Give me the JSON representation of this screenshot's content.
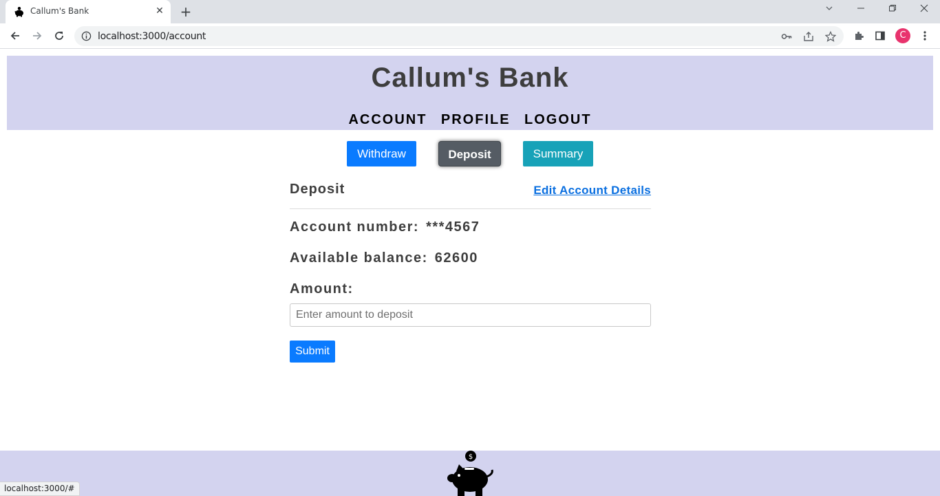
{
  "browser": {
    "tab_title": "Callum's Bank",
    "tab_close": "✕",
    "new_tab": "+",
    "url": "localhost:3000/account",
    "profile_initial": "C",
    "status_url": "localhost:3000/#"
  },
  "header": {
    "title": "Callum's Bank",
    "nav": [
      "ACCOUNT",
      "PROFILE",
      "LOGOUT"
    ]
  },
  "actions": {
    "withdraw": "Withdraw",
    "deposit": "Deposit",
    "summary": "Summary",
    "active": "Deposit"
  },
  "panel": {
    "title": "Deposit",
    "edit_link": "Edit Account Details",
    "account_number_label": "Account number:",
    "account_number_value": "***4567",
    "balance_label": "Available balance:",
    "balance_value": "62600",
    "amount_label": "Amount:",
    "amount_placeholder": "Enter amount to deposit",
    "amount_value": "",
    "submit_label": "Submit"
  },
  "footer": {
    "logo_icon": "piggy-bank-icon",
    "coin_symbol": "$"
  },
  "colors": {
    "header_bg": "#d3d3ef",
    "primary": "#0a7bff",
    "active": "#555c64",
    "info": "#17a2b8",
    "link": "#0a6fe0"
  }
}
